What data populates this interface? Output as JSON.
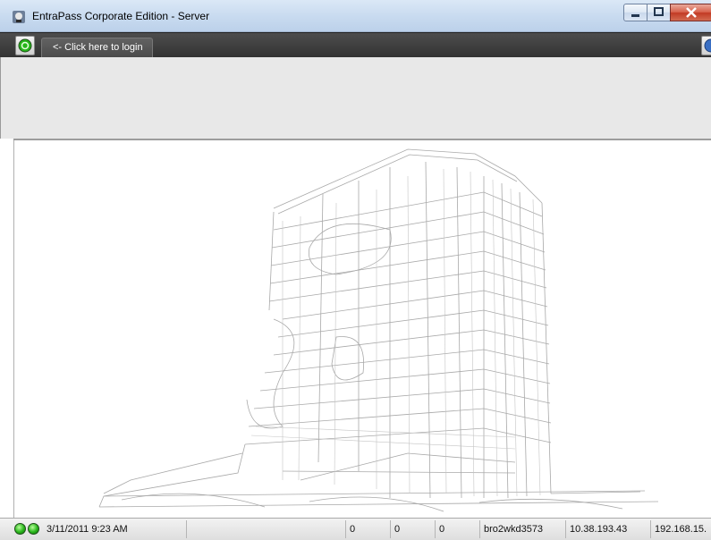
{
  "window": {
    "title": "EntraPass Corporate Edition - Server"
  },
  "toolbar": {
    "login_tab_label": "<- Click here to login"
  },
  "statusbar": {
    "datetime": "3/11/2011 9:23 AM",
    "counter_1": "0",
    "counter_2": "0",
    "counter_3": "0",
    "workstation": "bro2wkd3573",
    "ip_1": "10.38.193.43",
    "ip_2": "192.168.15."
  },
  "colors": {
    "toolbar_bg": "#3f3f3f",
    "panel_bg": "#e8e8e8",
    "status_led": "#27b51a",
    "close_button": "#c23a24"
  },
  "icons": [
    "app-icon",
    "status-led-icon",
    "help-icon",
    "minimize-icon",
    "maximize-icon",
    "close-icon"
  ]
}
